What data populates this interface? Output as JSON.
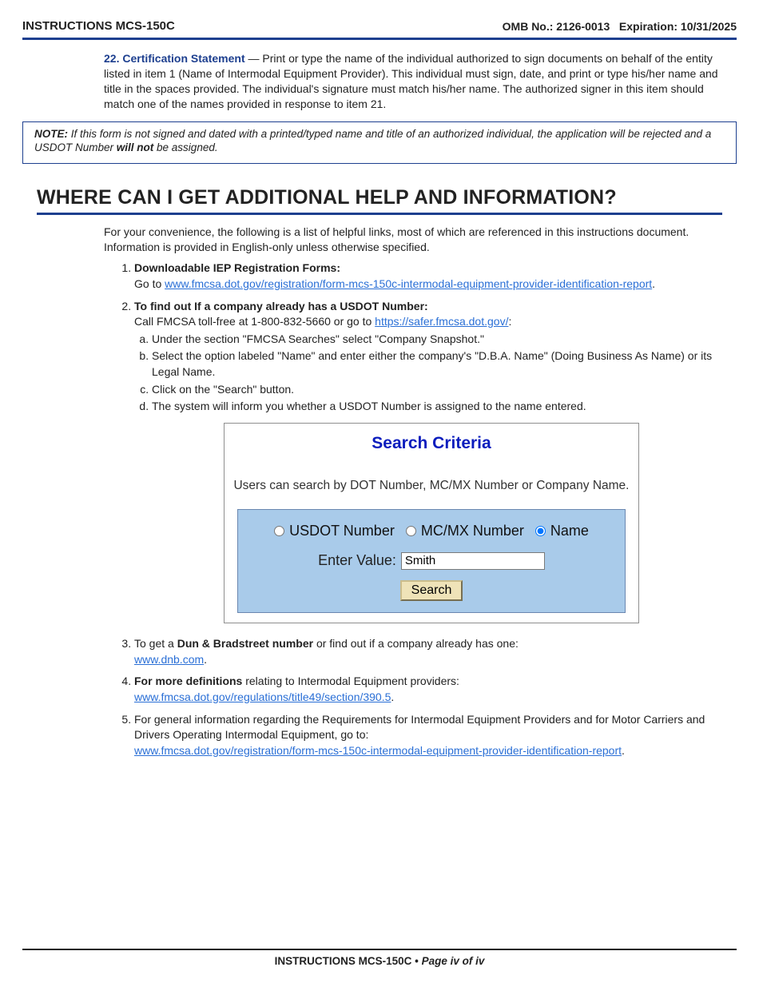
{
  "header": {
    "title_left": "INSTRUCTIONS MCS-150C",
    "omb_label": "OMB No.: 2126-0013",
    "expiration_label": "Expiration: 10/31/2025"
  },
  "certification": {
    "number_label": "22. Certification Statement",
    "dash": " — ",
    "body": "Print or type the name of the individual authorized to sign documents on behalf of the entity listed in item 1 (Name of Intermodal Equipment Provider). This individual must sign, date, and print or type his/her name and title in the spaces provided. The individual's signature must match his/her name. The authorized signer in this item should match one of the names provided in response to item 21."
  },
  "note": {
    "label": "NOTE:",
    "text_before": " If this form is not signed and dated with a printed/typed name and title of an authorized individual, the application will be rejected and a USDOT Number ",
    "will_not": "will not",
    "text_after": " be assigned."
  },
  "section_title": "WHERE CAN I GET ADDITIONAL HELP AND INFORMATION?",
  "intro": "For your convenience, the following is a list of helpful links, most of which are referenced in this instructions document. Information is provided in English-only unless otherwise specified.",
  "list": {
    "item1": {
      "lead": "Downloadable IEP Registration Forms:",
      "go_to": "Go to ",
      "link": "www.fmcsa.dot.gov/registration/form-mcs-150c-intermodal-equipment-provider-identification-report",
      "period": "."
    },
    "item2": {
      "lead": "To find out If a company already has a USDOT Number:",
      "call_before": "Call FMCSA toll-free at 1-800-832-5660 or go to ",
      "link": "https://safer.fmcsa.dot.gov/",
      "colon": ":",
      "sub_a": "Under the section \"FMCSA Searches\" select \"Company Snapshot.\"",
      "sub_b": "Select the option labeled \"Name\" and enter either the company's \"D.B.A. Name\" (Doing Business As Name) or its Legal Name.",
      "sub_c": "Click on the \"Search\" button.",
      "sub_d": "The system will inform you whether a USDOT Number is assigned to the name entered."
    },
    "item3": {
      "before": "To get a ",
      "bold": "Dun & Bradstreet number",
      "after": " or find out if a company already has one:",
      "link": "www.dnb.com",
      "period": "."
    },
    "item4": {
      "bold": "For more definitions",
      "after": " relating to Intermodal Equipment providers:",
      "link": "www.fmcsa.dot.gov/regulations/title49/section/390.5",
      "period": "."
    },
    "item5": {
      "text": "For general information regarding the Requirements for Intermodal Equipment Providers and for Motor Carriers and Drivers Operating Intermodal Equipment, go to:",
      "link": "www.fmcsa.dot.gov/registration/form-mcs-150c-intermodal-equipment-provider-identification-report",
      "period": "."
    }
  },
  "search_card": {
    "title": "Search Criteria",
    "description": "Users can search by DOT Number, MC/MX Number or Company Name.",
    "radio_usdot": "USDOT Number",
    "radio_mcmx": "MC/MX Number",
    "radio_name": "Name",
    "enter_label": "Enter Value:",
    "enter_value": "Smith",
    "search_button": "Search"
  },
  "footer": {
    "part1": "INSTRUCTIONS MCS-150C",
    "bullet": " • ",
    "part2": "Page iv of iv"
  }
}
